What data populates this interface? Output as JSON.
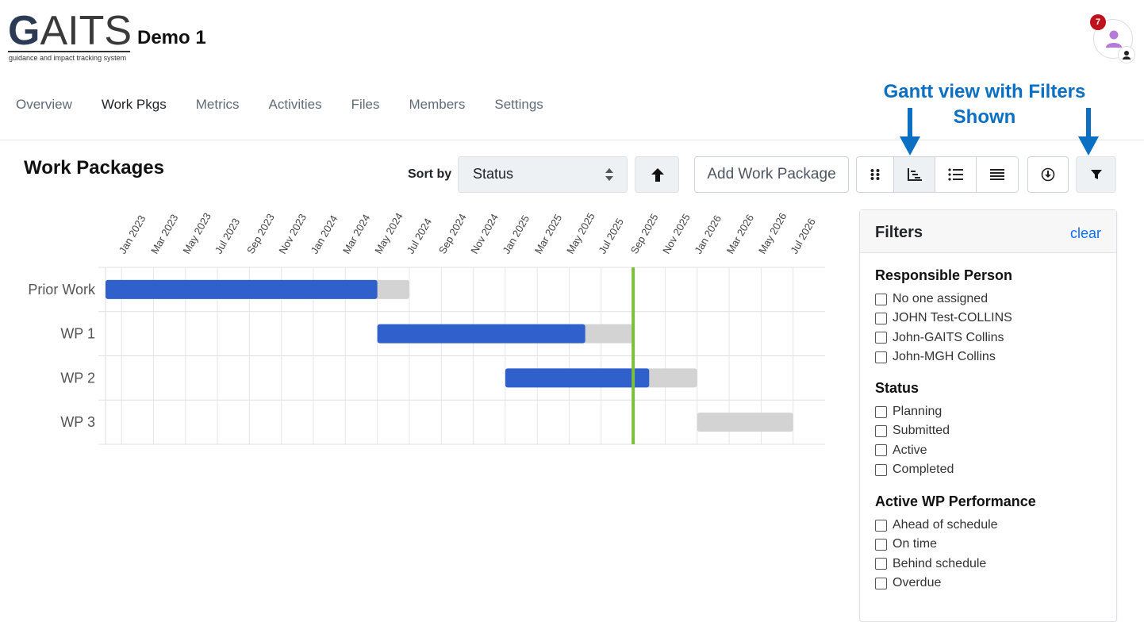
{
  "header": {
    "logo_text_g": "G",
    "logo_text_rest": "AITS",
    "logo_tagline": "guidance and impact tracking system",
    "project_title": "Demo 1",
    "notification_count": "7"
  },
  "nav": {
    "tabs": [
      {
        "label": "Overview",
        "active": false
      },
      {
        "label": "Work Pkgs",
        "active": true
      },
      {
        "label": "Metrics",
        "active": false
      },
      {
        "label": "Activities",
        "active": false
      },
      {
        "label": "Files",
        "active": false
      },
      {
        "label": "Members",
        "active": false
      },
      {
        "label": "Settings",
        "active": false
      }
    ]
  },
  "annotation": {
    "line1": "Gantt view with Filters",
    "line2": "Shown",
    "color": "#0b6fc4"
  },
  "toolbar": {
    "title": "Work Packages",
    "sort_label": "Sort by",
    "sort_value": "Status",
    "add_label": "Add Work Package",
    "icons": {
      "sort_direction": "arrow-up-icon",
      "views": [
        "grid-icon",
        "gantt-icon",
        "list-icon",
        "table-icon"
      ],
      "download": "download-icon",
      "filter": "filter-icon"
    }
  },
  "chart_data": {
    "type": "gantt",
    "x_ticks": [
      "Jan 2023",
      "Mar 2023",
      "May 2023",
      "Jul 2023",
      "Sep 2023",
      "Nov 2023",
      "Jan 2024",
      "Mar 2024",
      "May 2024",
      "Jul 2024",
      "Sep 2024",
      "Nov 2024",
      "Jan 2025",
      "Mar 2025",
      "May 2025",
      "Jul 2025",
      "Sep 2025",
      "Nov 2025",
      "Jan 2026",
      "Mar 2026",
      "May 2026",
      "Jul 2026"
    ],
    "x_range": [
      "2022-12",
      "2026-09"
    ],
    "today": "2025-09",
    "progress_color": "#3060cc",
    "remaining_color": "#d3d3d3",
    "today_color": "#7cbf3a",
    "rows": [
      {
        "label": "Prior Work",
        "start": "2022-12",
        "progress_end": "2024-05",
        "end": "2024-07"
      },
      {
        "label": "WP 1",
        "start": "2024-05",
        "progress_end": "2025-06",
        "end": "2025-09"
      },
      {
        "label": "WP 2",
        "start": "2025-01",
        "progress_end": "2025-10",
        "end": "2026-01"
      },
      {
        "label": "WP 3",
        "start": "2026-01",
        "progress_end": "2026-01",
        "end": "2026-07"
      }
    ]
  },
  "filters": {
    "title": "Filters",
    "clear_label": "clear",
    "groups": [
      {
        "title": "Responsible Person",
        "options": [
          "No one assigned",
          "JOHN Test-COLLINS",
          "John-GAITS Collins",
          "John-MGH Collins"
        ]
      },
      {
        "title": "Status",
        "options": [
          "Planning",
          "Submitted",
          "Active",
          "Completed"
        ]
      },
      {
        "title": "Active WP Performance",
        "options": [
          "Ahead of schedule",
          "On time",
          "Behind schedule",
          "Overdue"
        ]
      }
    ]
  }
}
